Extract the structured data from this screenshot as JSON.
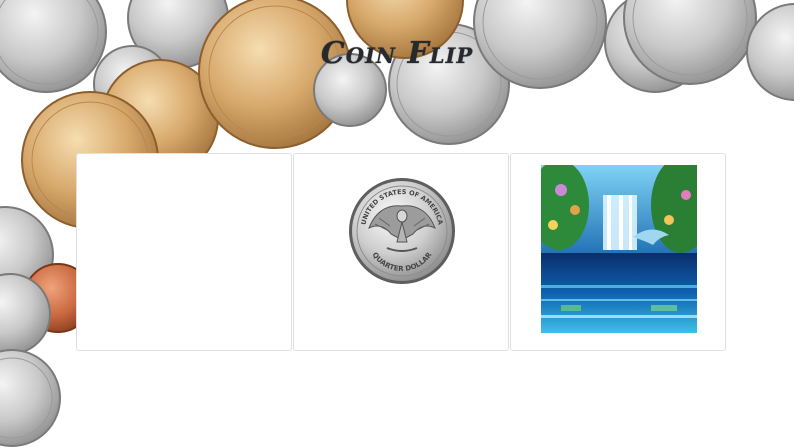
{
  "page": {
    "title": "Coin Flip"
  },
  "panels": [
    {
      "content": "empty"
    },
    {
      "content": "quarter-dollar-coin",
      "coin_legend_top": "UNITED STATES OF AMERICA",
      "coin_legend_bottom": "QUARTER DOLLAR"
    },
    {
      "content": "waterfall-image"
    }
  ],
  "colors": {
    "title": "#262a2e",
    "panel_border": "#e0e0e0",
    "background": "#ffffff"
  }
}
